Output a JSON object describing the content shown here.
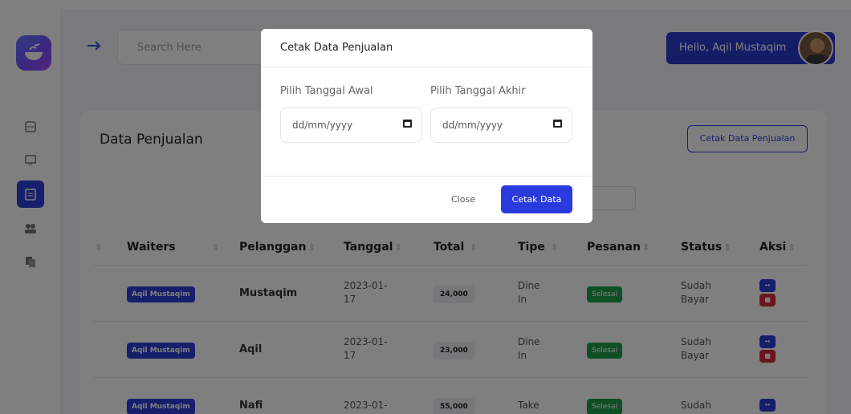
{
  "header": {
    "search_placeholder": "Search Here",
    "greeting": "Hello, Aqil Mustaqim"
  },
  "card": {
    "title": "Data Penjualan",
    "print_button": "Cetak Data Penjualan"
  },
  "table": {
    "headers": [
      "Waiters",
      "Pelanggan",
      "Tanggal",
      "Total",
      "Tipe",
      "Pesanan",
      "Status",
      "Aksi"
    ],
    "rows": [
      {
        "waiter": "Aqil Mustaqim",
        "pelanggan": "Mustaqim",
        "tanggal": "2023-01-17",
        "total": "24,000",
        "tipe": "Dine In",
        "pesanan": "Selesai",
        "status": "Sudah Bayar"
      },
      {
        "waiter": "Aqil Mustaqim",
        "pelanggan": "Aqil",
        "tanggal": "2023-01-17",
        "total": "23,000",
        "tipe": "Dine In",
        "pesanan": "Selesai",
        "status": "Sudah Bayar"
      },
      {
        "waiter": "Aqil Mustaqim",
        "pelanggan": "Nafi",
        "tanggal": "2023-01-",
        "total": "55,000",
        "tipe": "Take",
        "pesanan": "Selesai",
        "status": "Sudah"
      }
    ]
  },
  "modal": {
    "title": "Cetak Data Penjualan",
    "start_label": "Pilih Tanggal Awal",
    "end_label": "Pilih Tanggal Akhir",
    "start_value": "dd/mm/yyyy",
    "end_value": "dd/mm/yyyy",
    "close_label": "Close",
    "submit_label": "Cetak Data"
  },
  "colors": {
    "primary": "#2d3ed6",
    "success": "#1e9e4a",
    "danger": "#d9263d"
  },
  "icons": [
    "bowl-icon",
    "arrow-right-icon",
    "dashboard-icon",
    "monitor-icon",
    "clipboard-icon",
    "users-icon",
    "copy-icon",
    "calendar-icon"
  ]
}
